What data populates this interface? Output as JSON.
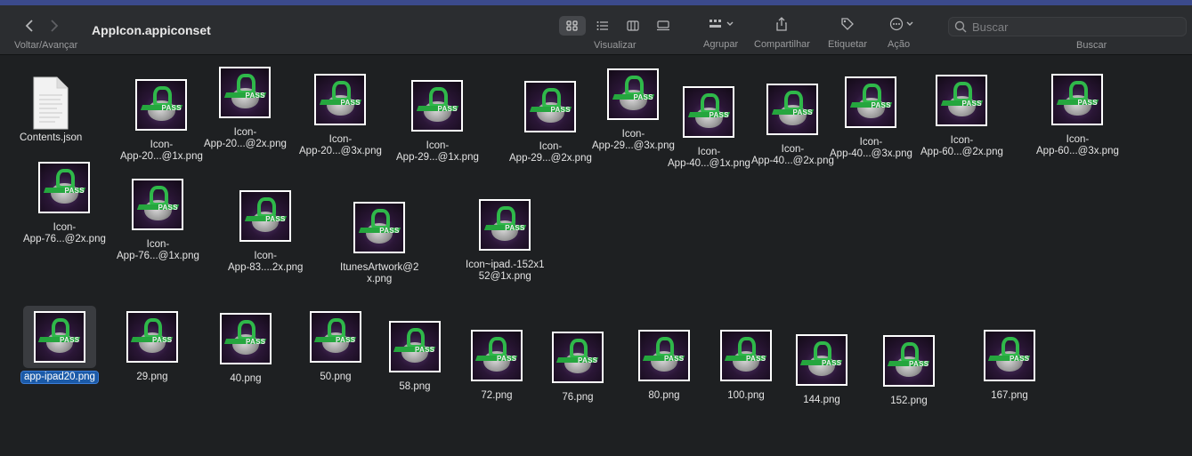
{
  "window": {
    "title": "AppIcon.appiconset"
  },
  "toolbar": {
    "nav_label": "Voltar/Avançar",
    "view_label": "Visualizar",
    "group_label": "Agrupar",
    "share_label": "Compartilhar",
    "tag_label": "Etiquetar",
    "action_label": "Ação",
    "search_label": "Buscar",
    "search_placeholder": "Buscar",
    "active_view": "icons"
  },
  "files": {
    "contents": "Contents.json",
    "icon1": [
      "Icon-",
      "App-20...@1x.png"
    ],
    "icon2": [
      "Icon-",
      "App-20...@2x.png"
    ],
    "icon3": [
      "Icon-",
      "App-20...@3x.png"
    ],
    "icon4": [
      "Icon-",
      "App-29...@1x.png"
    ],
    "icon5": [
      "Icon-",
      "App-29...@2x.png"
    ],
    "icon6": [
      "Icon-",
      "App-29...@3x.png"
    ],
    "icon7": [
      "Icon-",
      "App-40...@1x.png"
    ],
    "icon8": [
      "Icon-",
      "App-40...@2x.png"
    ],
    "icon9": [
      "Icon-",
      "App-40...@3x.png"
    ],
    "icon10": [
      "Icon-",
      "App-60...@2x.png"
    ],
    "icon11": [
      "Icon-",
      "App-60...@3x.png"
    ],
    "icon12": [
      "Icon-",
      "App-76...@2x.png"
    ],
    "icon13": [
      "Icon-",
      "App-76...@1x.png"
    ],
    "icon14": [
      "Icon-",
      "App-83....2x.png"
    ],
    "itunes": [
      "ItunesArtwork@2",
      "x.png"
    ],
    "ipad152": [
      "Icon~ipad.-152x1",
      "52@1x.png"
    ],
    "ipad20": "app-ipad20.png",
    "p29": "29.png",
    "p40": "40.png",
    "p50": "50.png",
    "p58": "58.png",
    "p72": "72.png",
    "p76": "76.png",
    "p80": "80.png",
    "p100": "100.png",
    "p144": "144.png",
    "p152": "152.png",
    "p167": "167.png"
  },
  "colors": {
    "background": "#1e2022",
    "toolbar": "#2b2d30",
    "selection": "#1b5aa8",
    "icon_green": "#2fb84a",
    "icon_purple": "#2a1636"
  }
}
